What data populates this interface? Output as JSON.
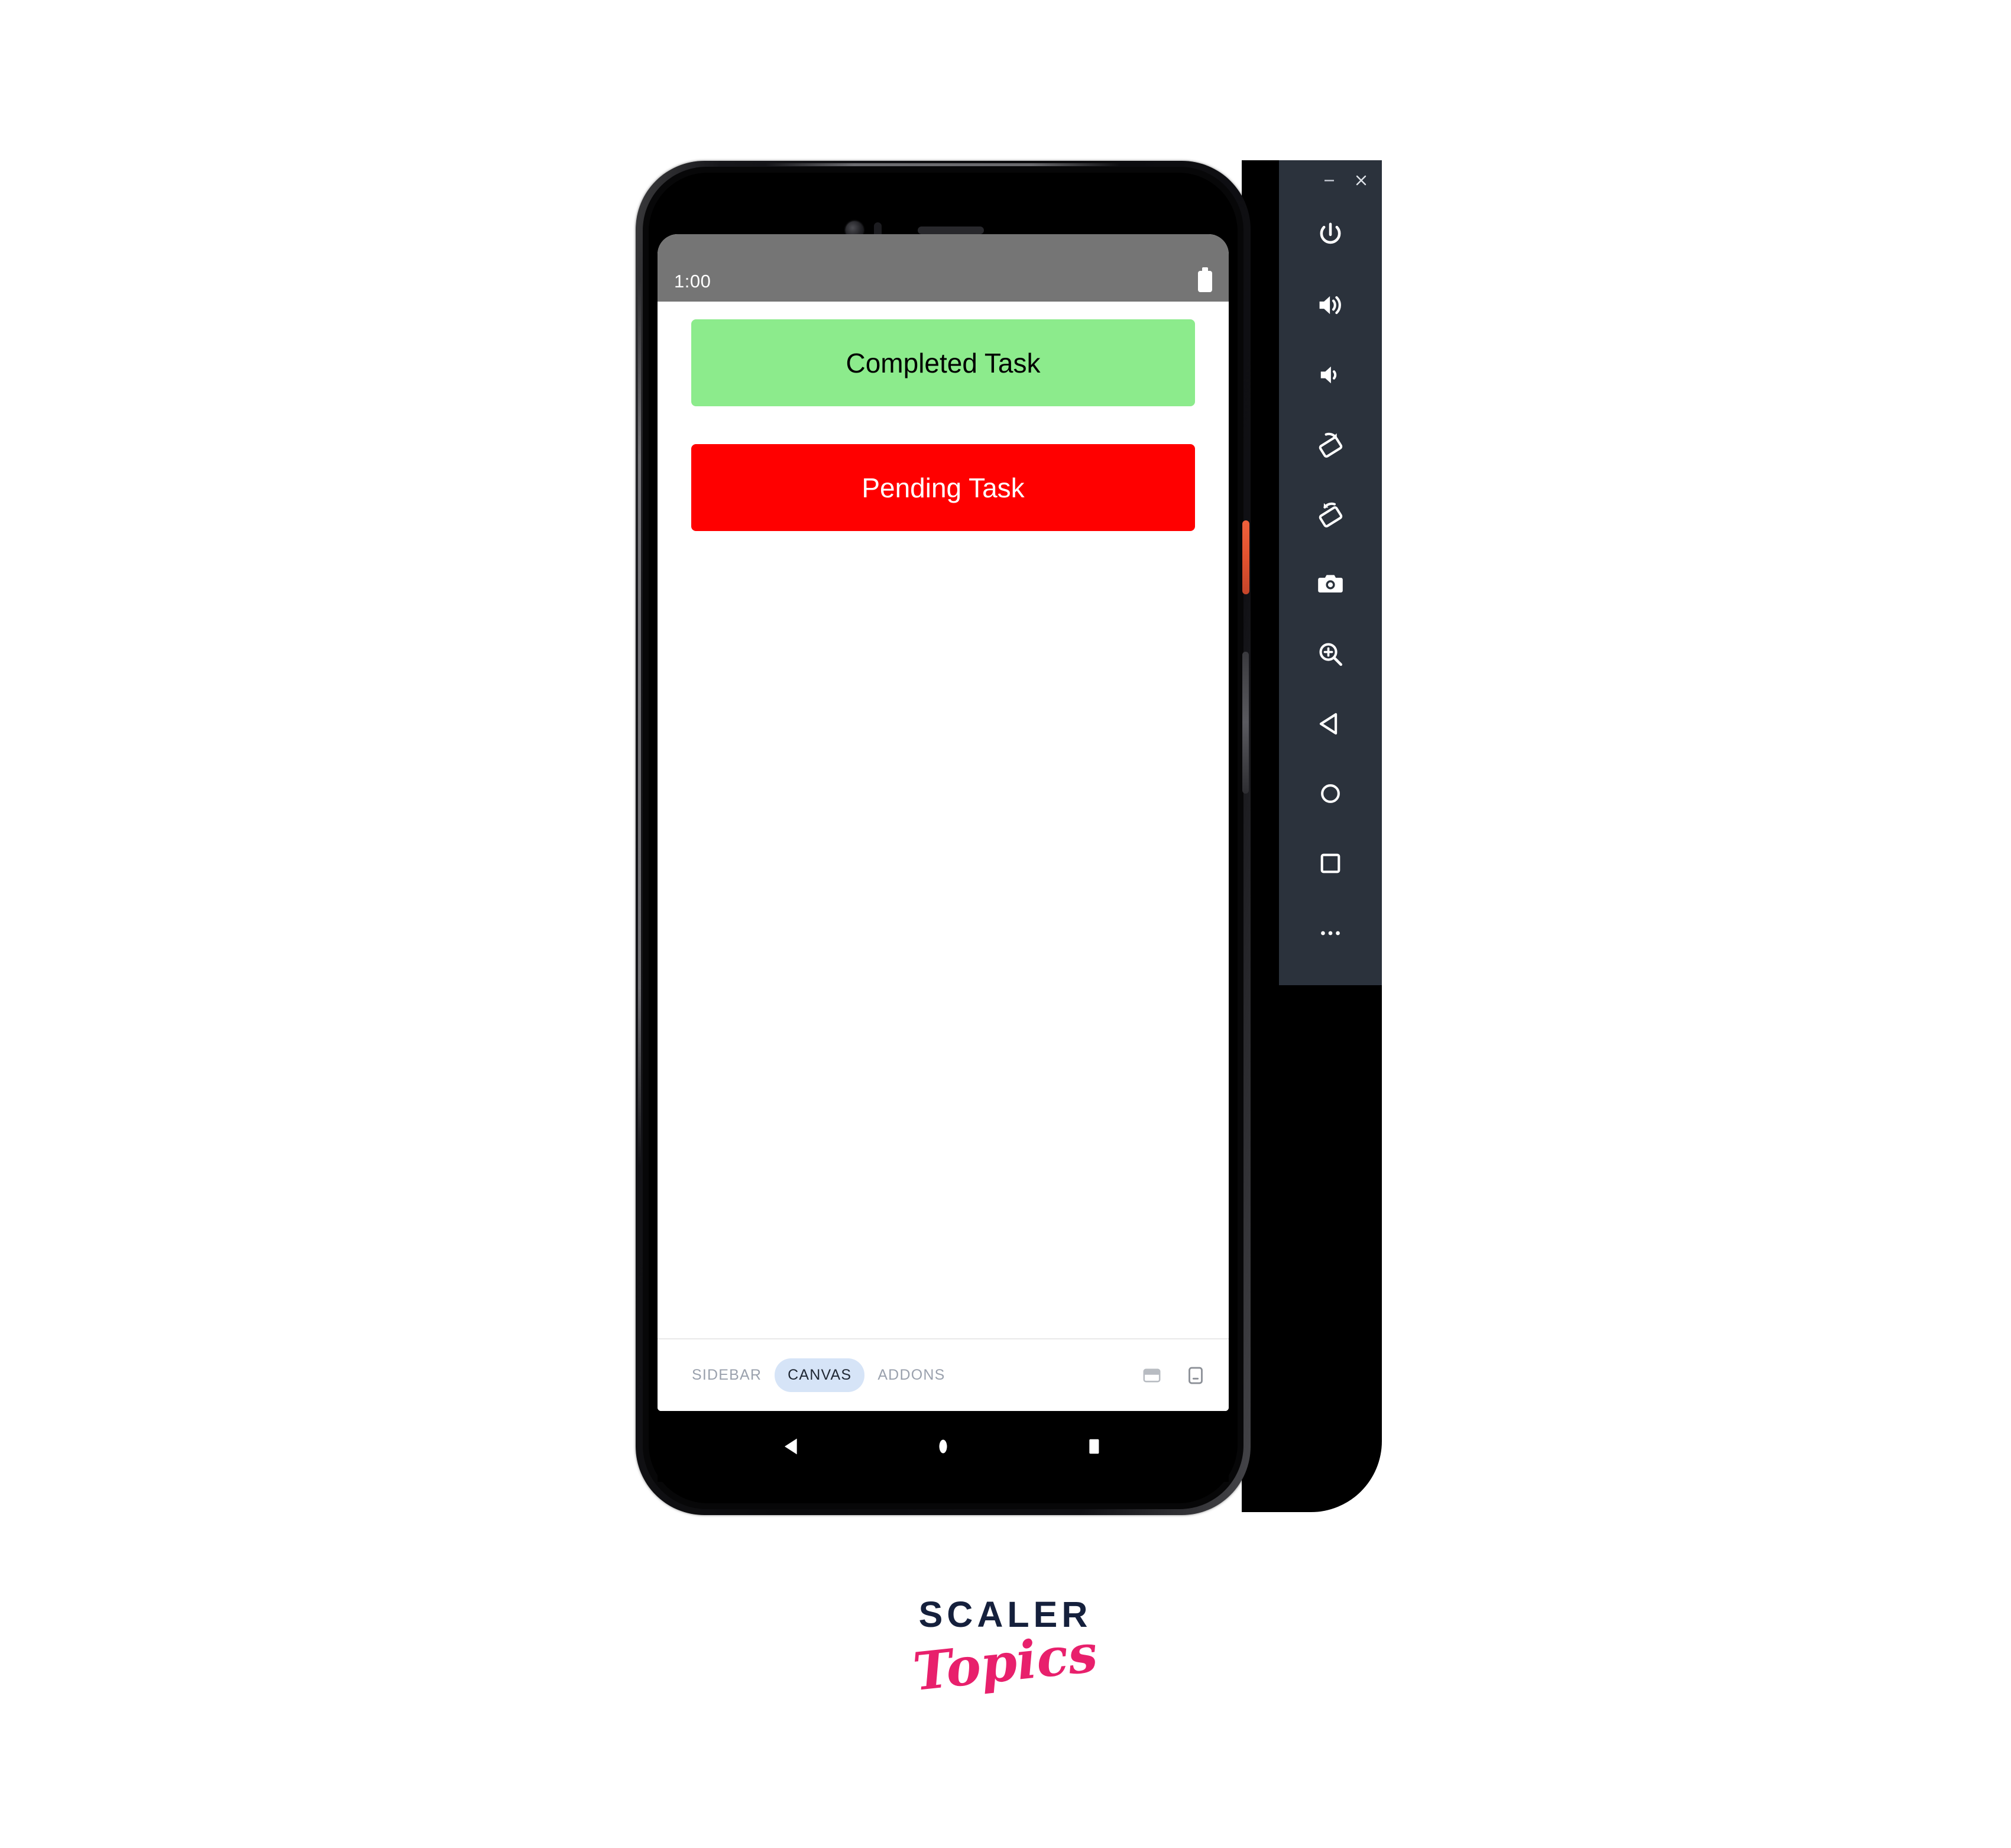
{
  "emulator": {
    "window_controls": [
      {
        "name": "minimize",
        "icon": "minimize-icon"
      },
      {
        "name": "close",
        "icon": "close-icon"
      }
    ],
    "side_buttons": [
      {
        "name": "power",
        "icon": "power-icon",
        "label": "Power"
      },
      {
        "name": "volume-up",
        "icon": "volume-up-icon",
        "label": "Volume Up"
      },
      {
        "name": "volume-down",
        "icon": "volume-down-icon",
        "label": "Volume Down"
      },
      {
        "name": "rotate-left",
        "icon": "rotate-left-icon",
        "label": "Rotate Left"
      },
      {
        "name": "rotate-right",
        "icon": "rotate-right-icon",
        "label": "Rotate Right"
      },
      {
        "name": "screenshot",
        "icon": "camera-icon",
        "label": "Take Screenshot"
      },
      {
        "name": "zoom",
        "icon": "zoom-in-icon",
        "label": "Zoom Mode"
      },
      {
        "name": "back",
        "icon": "back-triangle-icon",
        "label": "Back"
      },
      {
        "name": "home",
        "icon": "home-circle-icon",
        "label": "Home"
      },
      {
        "name": "overview",
        "icon": "overview-square-icon",
        "label": "Overview"
      },
      {
        "name": "more",
        "icon": "more-horizontal-icon",
        "label": "More"
      }
    ],
    "panel_color": "#2b323c"
  },
  "phone": {
    "status_bar": {
      "time": "1:00",
      "battery_icon": "battery-full-icon",
      "background_color": "#757575"
    },
    "app": {
      "background_color": "#ffffff",
      "buttons": [
        {
          "id": "completed-task",
          "label": "Completed Task",
          "background_color": "#8ceb8c",
          "text_color": "#000000"
        },
        {
          "id": "pending-task",
          "label": "Pending Task",
          "background_color": "#ff0000",
          "text_color": "#ffffff"
        }
      ]
    },
    "canvas_toolbar": {
      "tabs": [
        {
          "label": "SIDEBAR",
          "active": false
        },
        {
          "label": "CANVAS",
          "active": true
        },
        {
          "label": "ADDONS",
          "active": false
        }
      ],
      "active_tab_color": "#d6e4f7",
      "icons": [
        {
          "name": "panel-bottom-icon"
        },
        {
          "name": "device-preview-icon"
        }
      ]
    },
    "navigation_bar": {
      "keys": [
        {
          "name": "back",
          "icon": "back-triangle-icon"
        },
        {
          "name": "home",
          "icon": "home-circle-icon"
        },
        {
          "name": "recents",
          "icon": "recents-square-icon"
        }
      ],
      "background_color": "#000000"
    },
    "hardware": {
      "power_button_color": "#e2522f",
      "volume_rocker_color": "#4a4a4f"
    }
  },
  "branding": {
    "primary_text": "SCALER",
    "secondary_text": "Topics",
    "primary_color": "#15203c",
    "secondary_color": "#e8206c"
  }
}
